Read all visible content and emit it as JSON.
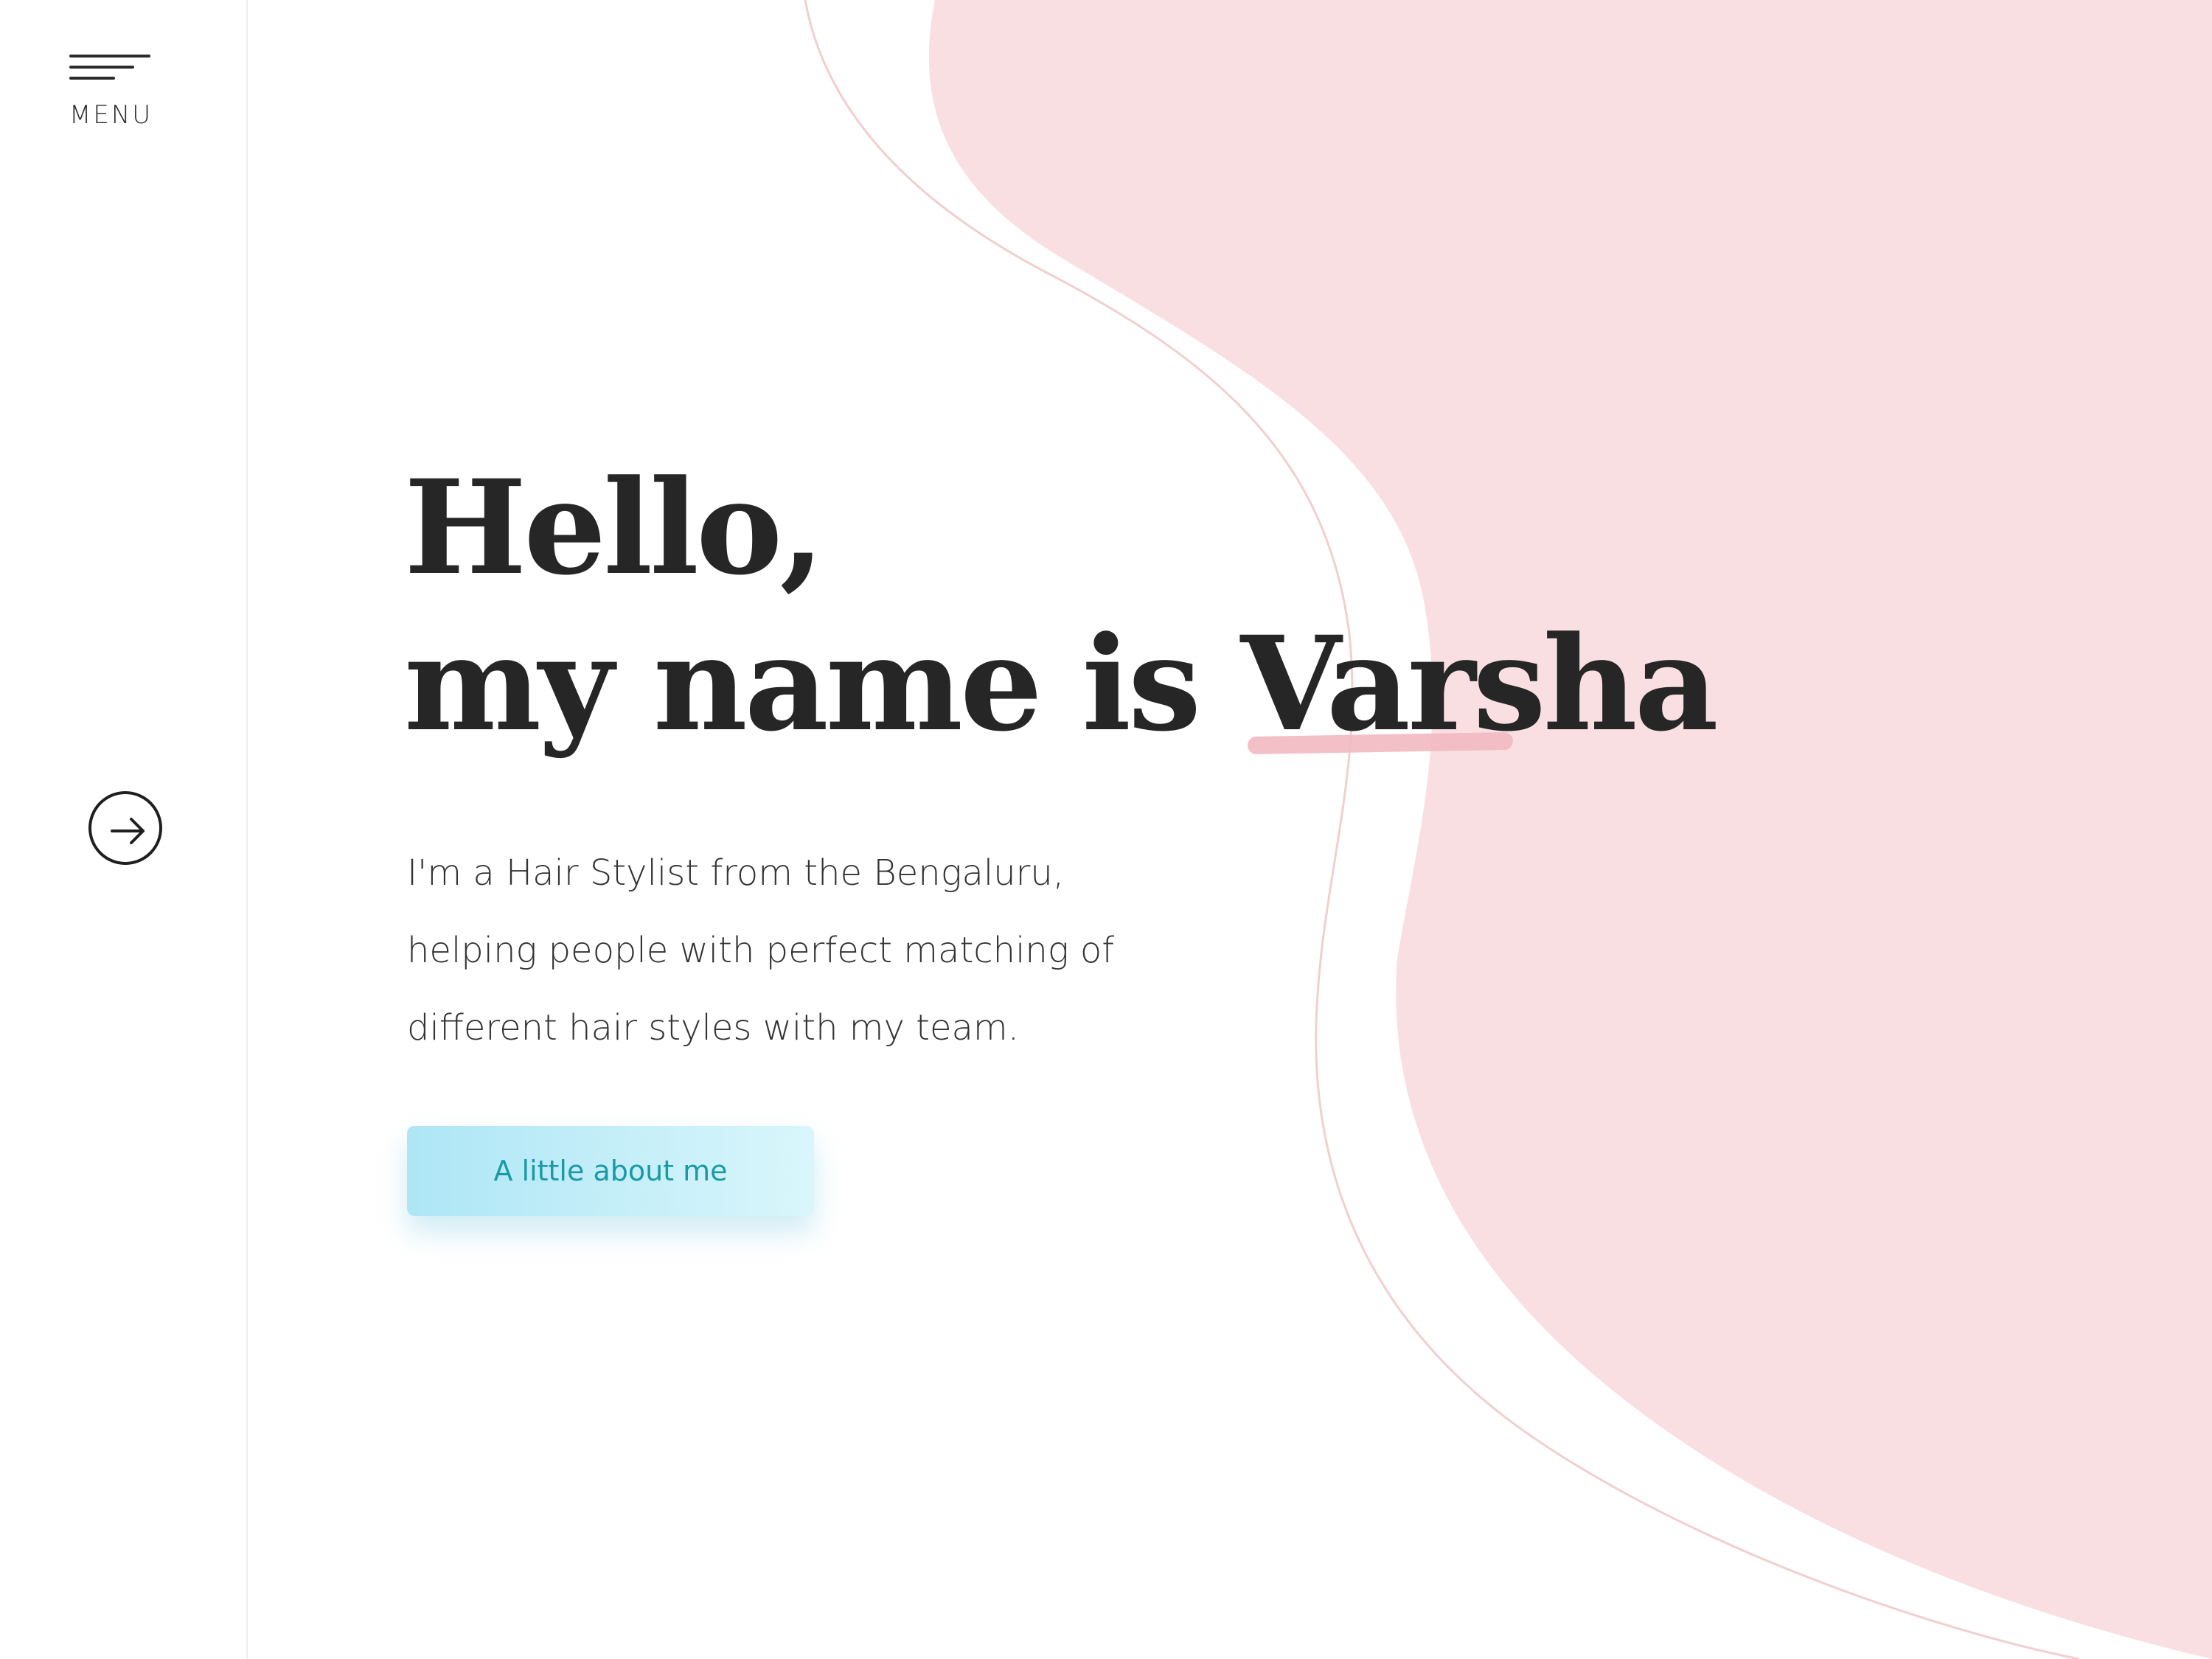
{
  "sidebar": {
    "menu_label": "MENU"
  },
  "hero": {
    "greeting": "Hello,",
    "name_prefix": "my name is ",
    "name": "Varsha",
    "description_lines": [
      "I'm a Hair Stylist from the Bengaluru,",
      "helping people with perfect matching of",
      "different hair styles with my team."
    ],
    "cta_label": "A little about me"
  },
  "colors": {
    "blob_pink": "#f9dfe2",
    "outline_pink": "#f1cfcf",
    "heading": "#262626",
    "cta_text": "#1a9aa6",
    "cta_gradient_start": "#aee6f6",
    "cta_gradient_end": "#d9f6fb",
    "underline_accent": "#f2b9c2"
  },
  "icons": {
    "menu": "hamburger-icon",
    "next": "arrow-right-icon"
  }
}
